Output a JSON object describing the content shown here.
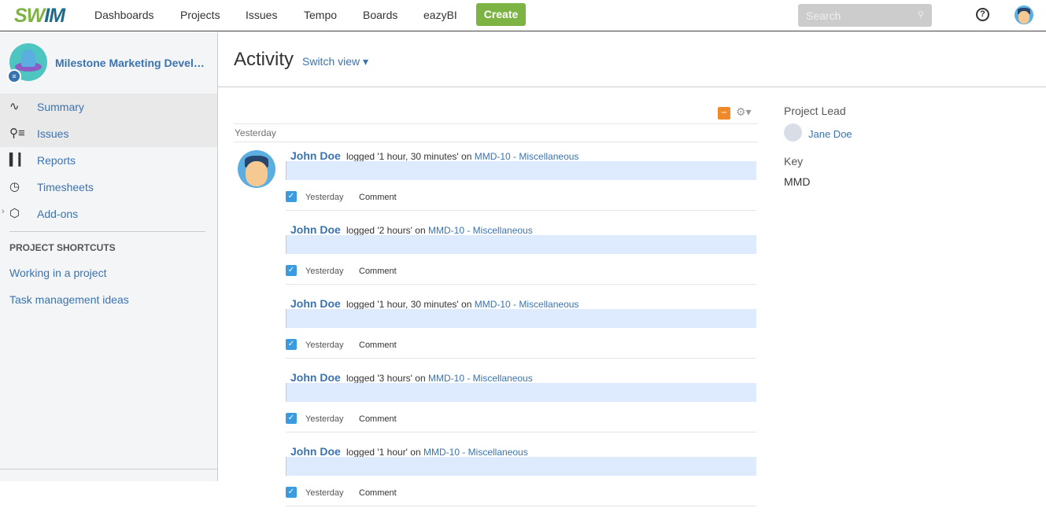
{
  "nav": {
    "logo": "SWIM",
    "items": [
      "Dashboards",
      "Projects",
      "Issues",
      "Tempo",
      "Boards",
      "eazyBI"
    ],
    "create": "Create",
    "search_placeholder": "Search",
    "help": "?"
  },
  "sidebar": {
    "project_name": "Milestone Marketing Devel…",
    "items": [
      {
        "label": "Summary",
        "icon": "pulse-icon"
      },
      {
        "label": "Issues",
        "icon": "search-list-icon"
      },
      {
        "label": "Reports",
        "icon": "bar-chart-icon"
      },
      {
        "label": "Timesheets",
        "icon": "clock-icon"
      },
      {
        "label": "Add-ons",
        "icon": "hexagon-icon"
      }
    ],
    "shortcuts_heading": "PROJECT SHORTCUTS",
    "shortcuts": [
      "Working in a project",
      "Task management ideas"
    ]
  },
  "main": {
    "title": "Activity",
    "switch_view": "Switch view ▾",
    "day": "Yesterday",
    "entries": [
      {
        "user": "John Doe",
        "action": "logged '1 hour, 30 minutes' on",
        "issue": "MMD-10 - Miscellaneous",
        "when": "Yesterday",
        "comment": "Comment"
      },
      {
        "user": "John Doe",
        "action": "logged '2 hours' on",
        "issue": "MMD-10 - Miscellaneous",
        "when": "Yesterday",
        "comment": "Comment"
      },
      {
        "user": "John Doe",
        "action": "logged '1 hour, 30 minutes' on",
        "issue": "MMD-10 - Miscellaneous",
        "when": "Yesterday",
        "comment": "Comment"
      },
      {
        "user": "John Doe",
        "action": "logged '3 hours' on",
        "issue": "MMD-10 - Miscellaneous",
        "when": "Yesterday",
        "comment": "Comment"
      },
      {
        "user": "John Doe",
        "action": "logged '1 hour' on",
        "issue": "MMD-10 - Miscellaneous",
        "when": "Yesterday",
        "comment": "Comment"
      }
    ]
  },
  "details": {
    "lead_label": "Project Lead",
    "lead": "Jane Doe",
    "key_label": "Key",
    "key": "MMD"
  }
}
